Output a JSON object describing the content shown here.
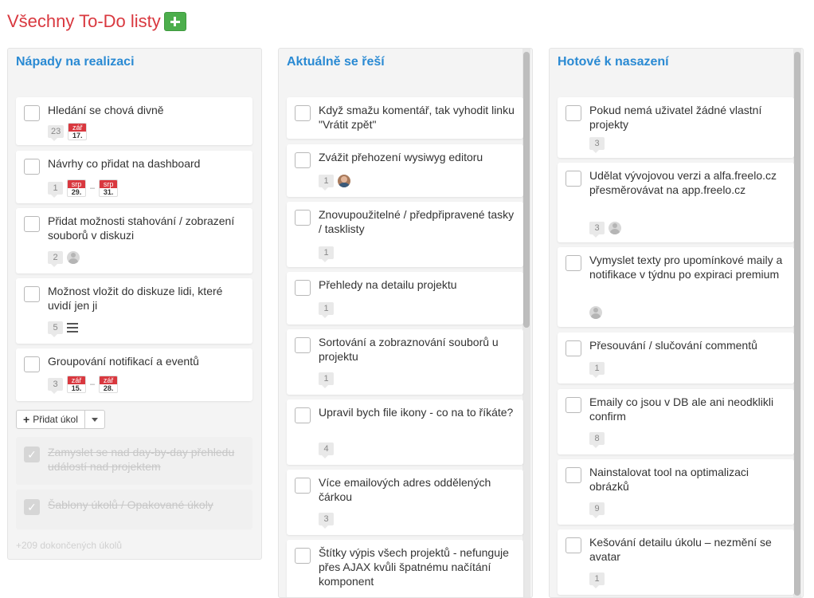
{
  "page": {
    "title": "Všechny To-Do listy"
  },
  "colors": {
    "title_red": "#d9383f",
    "list_blue": "#2a8ad3",
    "green": "#4cae4c",
    "date_red": "#d9383f"
  },
  "columns": [
    {
      "title": "Nápady na realizaci",
      "tasks": [
        {
          "title": "Hledání se chová divně",
          "comments": "23",
          "date_from": {
            "month": "zář",
            "day": "17."
          }
        },
        {
          "title": "Návrhy co přidat na dashboard",
          "comments": "1",
          "date_from": {
            "month": "srp",
            "day": "29."
          },
          "date_to": {
            "month": "srp",
            "day": "31."
          }
        },
        {
          "title": "Přidat možnosti stahování / zobrazení souborů v diskuzi",
          "comments": "2",
          "avatar": "user-icon"
        },
        {
          "title": "Možnost vložit do diskuze lidi, které uvidí jen ji",
          "comments": "5",
          "icon": "list-icon"
        },
        {
          "title": "Groupování notifikací a eventů",
          "comments": "3",
          "date_from": {
            "month": "zář",
            "day": "15."
          },
          "date_to": {
            "month": "zář",
            "day": "28."
          }
        }
      ],
      "add_task_label": "Přidat úkol",
      "done_tasks": [
        {
          "title": "Zamyslet se nad day-by-day přehledu událostí nad projektem"
        },
        {
          "title": "Šablony úkolů / Opakované úkoly"
        }
      ],
      "more_done": "+209 dokončených úkolů"
    },
    {
      "title": "Aktuálně se řeší",
      "tasks": [
        {
          "title": "Když smažu komentář, tak vyhodit linku \"Vrátit zpět\""
        },
        {
          "title": "Zvážit přehození wysiwyg editoru",
          "comments": "1",
          "avatar": "user-photo"
        },
        {
          "title": "Znovupoužitelné / předpřipravené tasky / tasklisty",
          "comments": "1"
        },
        {
          "title": "Přehledy na detailu projektu",
          "comments": "1"
        },
        {
          "title": "Sortování a zobraznování souborů u projektu",
          "comments": "1"
        },
        {
          "title": "Upravil bych file ikony - co na to říkáte?",
          "comments": "4"
        },
        {
          "title": "Více emailových adres oddělených čárkou",
          "comments": "3"
        },
        {
          "title": "Štítky výpis všech projektů - nefunguje přes AJAX kvůli špatnému načítání komponent"
        }
      ]
    },
    {
      "title": "Hotové k nasazení",
      "tasks": [
        {
          "title": "Pokud nemá uživatel žádné vlastní projekty",
          "comments": "3"
        },
        {
          "title": "Udělat vývojovou verzi a alfa.freelo.cz přesměrovávat na app.freelo.cz",
          "comments": "3",
          "avatar": "user-icon"
        },
        {
          "title": "Vymyslet texty pro upomínkové maily a notifikace v týdnu po expiraci premium",
          "avatar": "user-icon"
        },
        {
          "title": "Přesouvání / slučování commentů",
          "comments": "1"
        },
        {
          "title": "Emaily co jsou v DB ale ani neodklikli confirm",
          "comments": "8"
        },
        {
          "title": "Nainstalovat tool na optimalizaci obrázků",
          "comments": "9"
        },
        {
          "title": "Kešování detailu úkolu – nezmění se avatar",
          "comments": "1"
        }
      ]
    }
  ]
}
